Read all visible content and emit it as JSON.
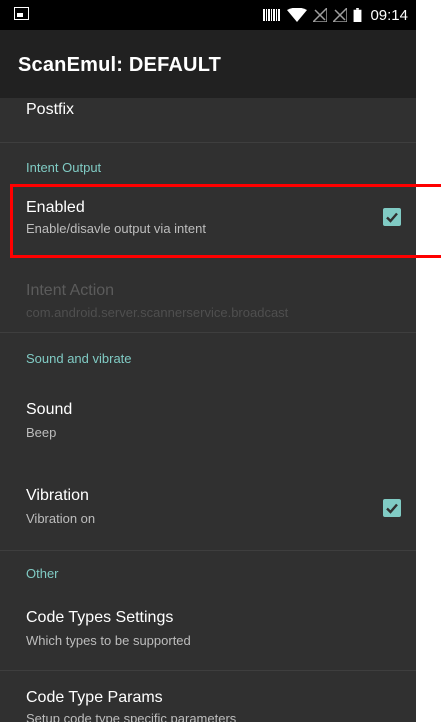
{
  "status_bar": {
    "time": "09:14",
    "icons": [
      "picture-icon",
      "barcode-icon",
      "wifi-icon",
      "signal-icon",
      "signal-icon",
      "battery-icon"
    ]
  },
  "toolbar": {
    "title": "ScanEmul: DEFAULT"
  },
  "prefs": {
    "postfix": {
      "title": "Postfix"
    },
    "intent_category": "Intent Output",
    "enabled": {
      "title": "Enabled",
      "summary": "Enable/disavle output via intent",
      "checked": true
    },
    "intent_action": {
      "title": "Intent Action",
      "summary": "com.android.server.scannerservice.broadcast",
      "disabled": true
    },
    "sound_category": "Sound and vibrate",
    "sound": {
      "title": "Sound",
      "summary": "Beep"
    },
    "vibration": {
      "title": "Vibration",
      "summary": "Vibration on",
      "checked": true
    },
    "other_category": "Other",
    "code_types": {
      "title": "Code Types Settings",
      "summary": "Which types to be supported"
    },
    "code_params": {
      "title": "Code Type Params",
      "summary": "Setup code type specific parameters"
    }
  },
  "colors": {
    "background": "#303030",
    "toolbar": "#212121",
    "accent": "#80cbc4",
    "highlight": "#ff0000"
  }
}
